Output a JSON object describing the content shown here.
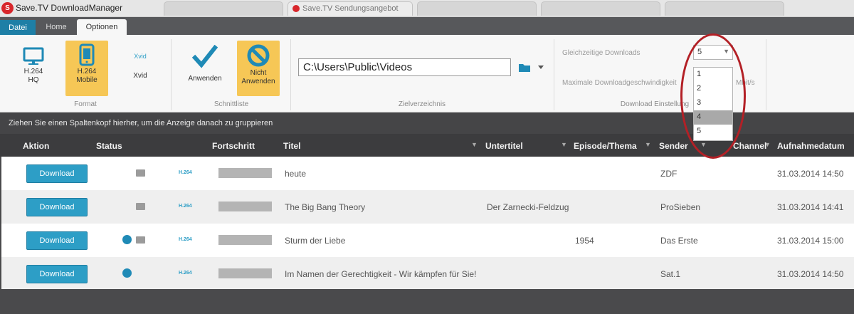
{
  "window": {
    "title": "Save.TV DownloadManager",
    "app_icon_letter": "S",
    "active_background_tab": "Save.TV Sendungsangebot"
  },
  "menu": {
    "tabs": [
      "Datei",
      "Home",
      "Optionen"
    ]
  },
  "ribbon": {
    "format": {
      "label": "Format",
      "buttons": [
        {
          "line1": "H.264",
          "line2": "HQ",
          "active": false
        },
        {
          "line1": "H.264",
          "line2": "Mobile",
          "active": true
        },
        {
          "line1": "Xvid",
          "line2": "",
          "active": false
        }
      ]
    },
    "schnittliste": {
      "label": "Schnittliste",
      "apply_label": "Anwenden",
      "not_apply_line1": "Nicht",
      "not_apply_line2": "Anwenden"
    },
    "zielverzeichnis": {
      "label": "Zielverzeichnis",
      "path": "C:\\Users\\Public\\Videos"
    },
    "download_settings": {
      "label": "Download Einstellung",
      "concurrent_label": "Gleichzeitige Downloads",
      "concurrent_value": "5",
      "max_speed_label": "Maximale Downloadgeschwindigkeit",
      "speed_unit": "Mbit/s",
      "options": [
        "1",
        "2",
        "3",
        "4",
        "5"
      ],
      "highlighted_option": "4"
    }
  },
  "group_hint": "Ziehen Sie einen Spaltenkopf hierher, um die Anzeige danach zu gruppieren",
  "columns": [
    "Aktion",
    "Status",
    "Fortschritt",
    "Titel",
    "Untertitel",
    "Episode/Thema",
    "Sender",
    "Channel",
    "Aufnahmedatum"
  ],
  "download_label": "Download",
  "format_badge": "H.264",
  "rows": [
    {
      "titel": "heute",
      "untertitel": "",
      "episode": "",
      "sender": "ZDF",
      "datum": "31.03.2014 14:50",
      "dot": false,
      "icon": true
    },
    {
      "titel": "The Big Bang Theory",
      "untertitel": "Der Zarnecki-Feldzug",
      "episode": "",
      "sender": "ProSieben",
      "datum": "31.03.2014 14:41",
      "dot": false,
      "icon": true
    },
    {
      "titel": "Sturm der Liebe",
      "untertitel": "",
      "episode": "1954",
      "sender": "Das Erste",
      "datum": "31.03.2014 15:00",
      "dot": true,
      "icon": true
    },
    {
      "titel": "Im Namen der Gerechtigkeit - Wir kämpfen für Sie!",
      "untertitel": "",
      "episode": "",
      "sender": "Sat.1",
      "datum": "31.03.2014 14:50",
      "dot": true,
      "icon": false
    }
  ],
  "colors": {
    "accent": "#2d9ec6",
    "active_button": "#f6c756",
    "annotation": "#b32026",
    "header_bg": "#3c3c3e"
  }
}
